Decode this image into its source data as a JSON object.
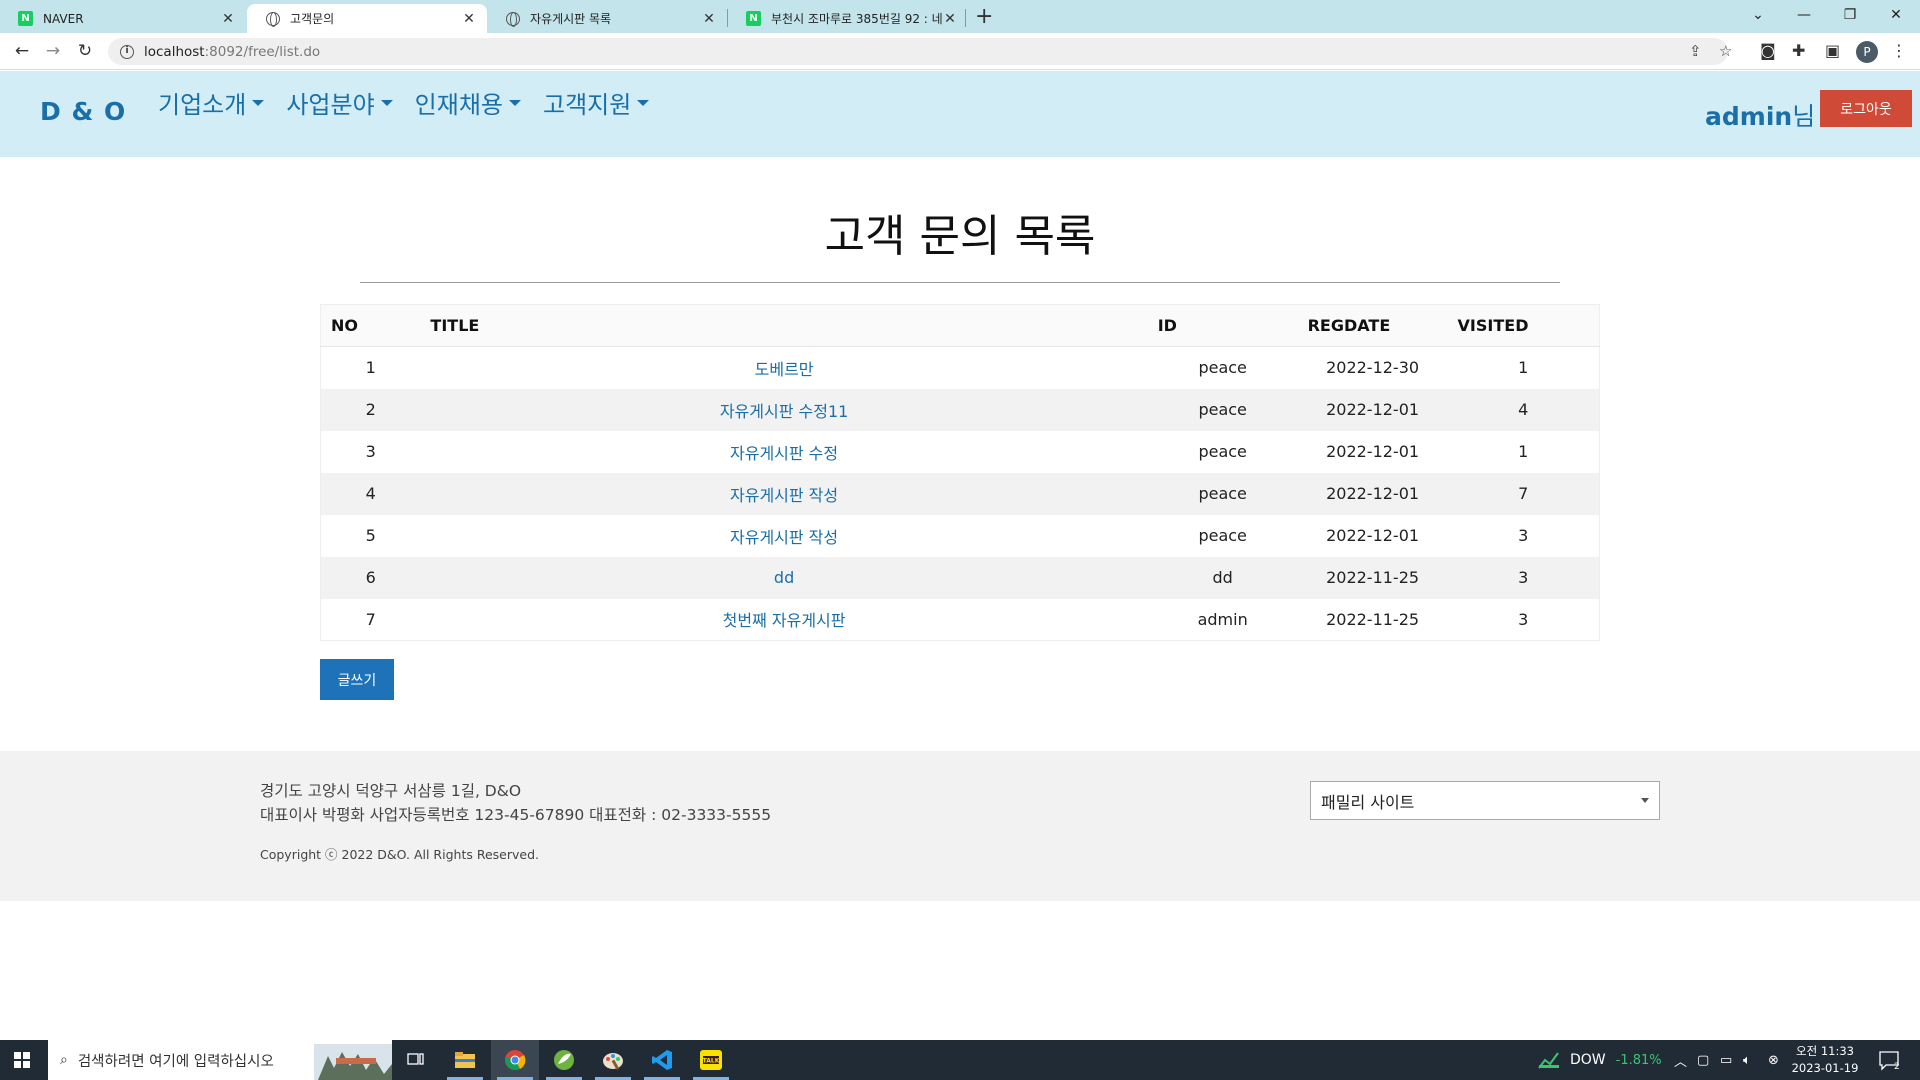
{
  "browser": {
    "tabs": [
      {
        "title": "NAVER",
        "favicon": "naver-icon",
        "active": false
      },
      {
        "title": "고객문의",
        "favicon": "globe-icon",
        "active": true
      },
      {
        "title": "자유게시판 목록",
        "favicon": "globe-icon",
        "active": false
      },
      {
        "title": "부천시 조마루로 385번길 92 : 네",
        "favicon": "naver-icon",
        "active": false
      }
    ],
    "new_tab": "+",
    "url_host": "localhost",
    "url_path": ":8092/free/list.do",
    "profile_initial": "P"
  },
  "header": {
    "logo": "D & O",
    "menu": [
      "기업소개",
      "사업분야",
      "인재채용",
      "고객지원"
    ],
    "user_name": "admin",
    "user_suffix": "님",
    "logout_label": "로그아웃"
  },
  "main": {
    "title": "고객 문의 목록",
    "columns": [
      "NO",
      "TITLE",
      "ID",
      "REGDATE",
      "VISITED"
    ],
    "rows": [
      {
        "no": "1",
        "title": "도베르만",
        "id": "peace",
        "regdate": "2022-12-30",
        "visited": "1"
      },
      {
        "no": "2",
        "title": "자유게시판 수정11",
        "id": "peace",
        "regdate": "2022-12-01",
        "visited": "4"
      },
      {
        "no": "3",
        "title": "자유게시판 수정",
        "id": "peace",
        "regdate": "2022-12-01",
        "visited": "1"
      },
      {
        "no": "4",
        "title": "자유게시판 작성",
        "id": "peace",
        "regdate": "2022-12-01",
        "visited": "7"
      },
      {
        "no": "5",
        "title": "자유게시판 작성",
        "id": "peace",
        "regdate": "2022-12-01",
        "visited": "3"
      },
      {
        "no": "6",
        "title": "dd",
        "id": "dd",
        "regdate": "2022-11-25",
        "visited": "3"
      },
      {
        "no": "7",
        "title": "첫번째 자유게시판",
        "id": "admin",
        "regdate": "2022-11-25",
        "visited": "3"
      }
    ],
    "write_label": "글쓰기"
  },
  "footer": {
    "address": "경기도 고양시 덕양구 서삼릉 1길, D&O",
    "business": "대표이사 박평화 사업자등록번호 123-45-67890 대표전화 : 02-3333-5555",
    "copyright": "Copyright ⓒ 2022 D&O. All Rights Reserved.",
    "family_site": "패밀리 사이트"
  },
  "taskbar": {
    "search_placeholder": "검색하려면 여기에 입력하십시오",
    "stock_name": "DOW",
    "stock_change": "-1.81%",
    "time": "오전 11:33",
    "date": "2023-01-19",
    "notification_count": "2"
  },
  "colors": {
    "tabstrip": "#c3e4ea",
    "header_bg": "#d3edf6",
    "brand_blue": "#1a6fa8",
    "logout_red": "#d04b37",
    "write_button": "#1d72b8",
    "stock_green": "#3ec46d"
  }
}
